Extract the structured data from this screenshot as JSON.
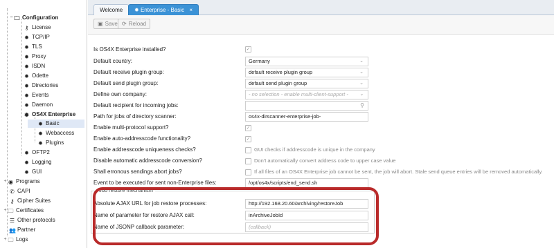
{
  "sidebar": {
    "items": [
      {
        "label": "Configuration",
        "icon": "folder-open-icon",
        "bold": true
      },
      {
        "label": "License",
        "icon": "key-icon"
      },
      {
        "label": "TCP/IP",
        "icon": "gear-icon"
      },
      {
        "label": "TLS",
        "icon": "gear-icon"
      },
      {
        "label": "Proxy",
        "icon": "gear-icon"
      },
      {
        "label": "ISDN",
        "icon": "gear-icon"
      },
      {
        "label": "Odette",
        "icon": "gear-icon"
      },
      {
        "label": "Directories",
        "icon": "gear-icon"
      },
      {
        "label": "Events",
        "icon": "gear-icon"
      },
      {
        "label": "Daemon",
        "icon": "gear-icon"
      },
      {
        "label": "OS4X Enterprise",
        "icon": "gear-icon",
        "bold": true
      },
      {
        "label": "Basic",
        "icon": "gear-icon",
        "selected": true
      },
      {
        "label": "Webaccess",
        "icon": "gear-icon"
      },
      {
        "label": "Plugins",
        "icon": "gear-icon"
      },
      {
        "label": "OFTP2",
        "icon": "gear-icon"
      },
      {
        "label": "Logging",
        "icon": "gear-icon"
      },
      {
        "label": "GUI",
        "icon": "gear-icon"
      },
      {
        "label": "Programs",
        "icon": "programs-icon"
      },
      {
        "label": "CAPI",
        "icon": "phone-icon"
      },
      {
        "label": "Cipher Suites",
        "icon": "key-icon"
      },
      {
        "label": "Certificates",
        "icon": "folder-icon"
      },
      {
        "label": "Other protocols",
        "icon": "list-icon"
      },
      {
        "label": "Partner",
        "icon": "users-icon"
      },
      {
        "label": "Logs",
        "icon": "folder-icon"
      }
    ]
  },
  "tabs": [
    {
      "label": "Welcome"
    },
    {
      "label": "Enterprise - Basic",
      "close": "×"
    }
  ],
  "toolbar": {
    "save_label": "Save",
    "reload_label": "Reload"
  },
  "form": {
    "installed_label": "Is OS4X Enterprise installed?",
    "country_label": "Default country:",
    "country_value": "Germany",
    "receive_plugin_label": "Default receive plugin group:",
    "receive_plugin_value": "default receive plugin group",
    "send_plugin_label": "Default send plugin group:",
    "send_plugin_value": "default send plugin group",
    "own_company_label": "Define own company:",
    "own_company_value": "- no selection - enable multi-client-support -",
    "recipient_label": "Default recipient for incoming jobs:",
    "recipient_value": "",
    "path_label": "Path for jobs of directory scanner:",
    "path_value": "os4x-dirscanner-enterprise-job-",
    "multiprotocol_label": "Enable multi-protocol support?",
    "autoaddress_label": "Enable auto-addresscode functionality?",
    "uniqueness_label": "Enable addresscode uniqueness checks?",
    "uniqueness_desc": "GUI checks if addresscode is unique in the company",
    "disable_conv_label": "Disable automatic addresscode conversion?",
    "disable_conv_desc": "Don't automatically convert address code to upper case value",
    "abort_label": "Shall erronous sendings abort jobs?",
    "abort_desc": "If all files of an OS4X Enterprise job cannot be sent, the job will abort. Stale send queue entries will be removed automatically.",
    "event_label": "Event to be executed for sent non-Enterprise files:",
    "event_value": "/opt/os4x/scripts/end_send.sh",
    "restore_legend": "Job restore mechanism",
    "ajax_url_label": "Absolute AJAX URL for job restore processes:",
    "ajax_url_value": "http://192.168.20.60/archiving/restoreJob",
    "param_label": "Name of parameter for restore AJAX call:",
    "param_value": "inArchiveJobId",
    "jsonp_label": "Name of JSONP callback parameter:",
    "jsonp_placeholder": "(callback)"
  },
  "colors": {
    "accent": "#3b92d6",
    "highlight": "#b92a2a",
    "selected": "#dfe8f6"
  },
  "glyphs": {
    "check": "✓",
    "chevron": "⌄",
    "search": "⚲"
  }
}
